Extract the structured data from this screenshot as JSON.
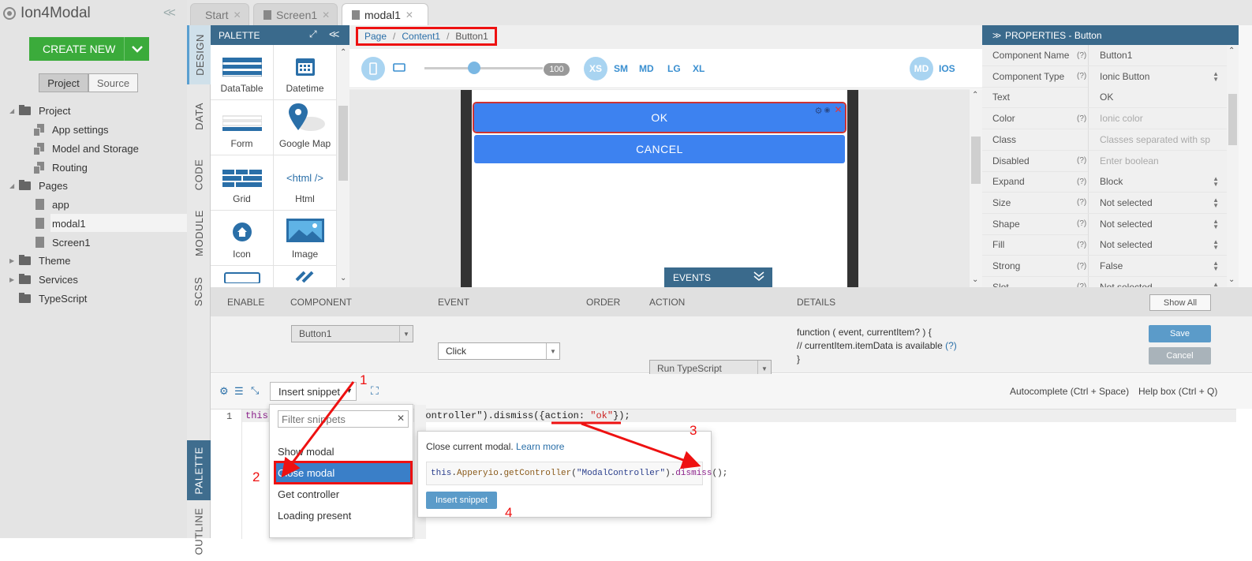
{
  "app": {
    "title": "Ion4Modal",
    "create_label": "CREATE NEW",
    "project_tab": "Project",
    "source_tab": "Source"
  },
  "tree": [
    {
      "label": "Project",
      "type": "folder"
    },
    {
      "label": "App settings",
      "type": "cfile"
    },
    {
      "label": "Model and Storage",
      "type": "cfile"
    },
    {
      "label": "Routing",
      "type": "cfile"
    },
    {
      "label": "Pages",
      "type": "folder"
    },
    {
      "label": "app",
      "type": "file"
    },
    {
      "label": "modal1",
      "type": "file"
    },
    {
      "label": "Screen1",
      "type": "file"
    },
    {
      "label": "Theme",
      "type": "folder"
    },
    {
      "label": "Services",
      "type": "folder"
    },
    {
      "label": "TypeScript",
      "type": "folder"
    }
  ],
  "tabs": [
    {
      "label": "Start"
    },
    {
      "label": "Screen1"
    },
    {
      "label": "modal1"
    }
  ],
  "vtabs": [
    "DESIGN",
    "DATA",
    "CODE",
    "MODULE",
    "SCSS",
    "PALETTE",
    "OUTLINE"
  ],
  "palette": {
    "title": "PALETTE",
    "items": [
      "DataTable",
      "Datetime",
      "Form",
      "Google Map",
      "Grid",
      "Html",
      "Icon",
      "Image"
    ]
  },
  "breadcrumb": {
    "page": "Page",
    "content": "Content1",
    "current": "Button1"
  },
  "toolbar": {
    "zoom": "100",
    "xs": "XS",
    "sm": "SM",
    "md": "MD",
    "lg": "LG",
    "xl": "XL",
    "mode_md": "MD",
    "mode_ios": "IOS",
    "slider_level": 0.42
  },
  "canvas": {
    "ok": "OK",
    "cancel": "CANCEL",
    "events": "EVENTS"
  },
  "properties": {
    "title": "PROPERTIES - Button",
    "rows": [
      {
        "k": "Component Name",
        "h": "(?)",
        "v": "Button1",
        "ph": false,
        "sel": false
      },
      {
        "k": "Component Type",
        "h": "(?)",
        "v": "Ionic Button",
        "ph": false,
        "sel": true
      },
      {
        "k": "Text",
        "h": "",
        "v": "OK",
        "ph": false,
        "sel": false
      },
      {
        "k": "Color",
        "h": "(?)",
        "v": "Ionic color",
        "ph": true,
        "sel": false
      },
      {
        "k": "Class",
        "h": "",
        "v": "Classes separated with sp",
        "ph": true,
        "sel": false
      },
      {
        "k": "Disabled",
        "h": "(?)",
        "v": "Enter boolean",
        "ph": true,
        "sel": false
      },
      {
        "k": "Expand",
        "h": "(?)",
        "v": "Block",
        "ph": false,
        "sel": true
      },
      {
        "k": "Size",
        "h": "(?)",
        "v": "Not selected",
        "ph": false,
        "sel": true
      },
      {
        "k": "Shape",
        "h": "(?)",
        "v": "Not selected",
        "ph": false,
        "sel": true
      },
      {
        "k": "Fill",
        "h": "(?)",
        "v": "Not selected",
        "ph": false,
        "sel": true
      },
      {
        "k": "Strong",
        "h": "(?)",
        "v": "False",
        "ph": false,
        "sel": true
      },
      {
        "k": "Slot",
        "h": "(?)",
        "v": "Not selected",
        "ph": false,
        "sel": true
      }
    ]
  },
  "events": {
    "headers": {
      "enable": "ENABLE",
      "component": "COMPONENT",
      "event": "EVENT",
      "order": "ORDER",
      "action": "ACTION",
      "details": "DETAILS"
    },
    "show_all": "Show All",
    "component": "Button1",
    "event": "Click",
    "action": "Run TypeScript",
    "details1": "function ( event, currentItem? ) {",
    "details2": "// currentItem.itemData is available ",
    "details2_help": "(?)",
    "details3": "}",
    "save": "Save",
    "cancel": "Cancel"
  },
  "code": {
    "insert_snippet": "Insert snippet",
    "autocomplete": "Autocomplete (Ctrl + Space)",
    "helpbox": "Help box (Ctrl + Q)",
    "line_no": "1",
    "line_a": "this",
    "line_b": "lController\").dismiss({",
    "line_c": "action: ",
    "line_d": "\"ok\"",
    "line_e": "});",
    "filter_placeholder": "Filter snippets",
    "snippets": [
      "Show modal",
      "Close modal",
      "Get controller",
      "Loading present"
    ],
    "tip_text": "Close current modal. ",
    "tip_link": "Learn more",
    "tip_code_a": "this",
    "tip_code_b": ".",
    "tip_code_c": "Apperyio",
    "tip_code_d": ".",
    "tip_code_e": "getController",
    "tip_code_f": "(",
    "tip_code_g": "\"ModalController\"",
    "tip_code_h": ").",
    "tip_code_i": "dismiss",
    "tip_code_j": "();",
    "tip_button": "Insert snippet"
  },
  "annotations": [
    "1",
    "2",
    "3",
    "4"
  ],
  "colors": {
    "accent": "#e11111",
    "green": "#3bab3b",
    "blue_btn": "#3d82f0",
    "header": "#3a6a8c"
  }
}
